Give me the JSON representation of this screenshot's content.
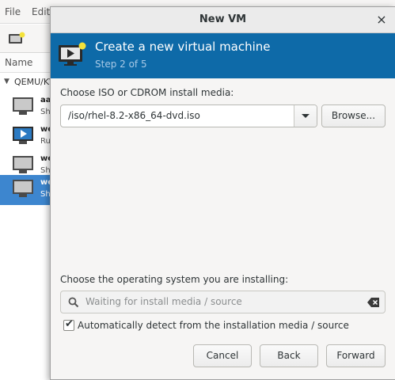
{
  "parent_window": {
    "menu": [
      "File",
      "Edit"
    ],
    "column_header": "Name",
    "group_label": "QEMU/KV",
    "vms": [
      {
        "name": "aa",
        "status": "Sh",
        "icon": "vm-shutoff-icon",
        "selected": false
      },
      {
        "name": "we",
        "status": "Ru",
        "icon": "vm-running-icon",
        "selected": false
      },
      {
        "name": "we",
        "status": "Sh",
        "icon": "vm-shutoff-icon",
        "selected": false
      },
      {
        "name": "we",
        "status": "Sh",
        "icon": "vm-shutoff-icon",
        "selected": true
      }
    ]
  },
  "dialog": {
    "title": "New VM",
    "close_glyph": "×",
    "banner": {
      "heading": "Create a new virtual machine",
      "step": "Step 2 of 5"
    },
    "media_label": "Choose ISO or CDROM install media:",
    "media_value": "/iso/rhel-8.2-x86_64-dvd.iso",
    "browse_label": "Browse...",
    "os_label": "Choose the operating system you are installing:",
    "os_search_placeholder": "Waiting for install media / source",
    "auto_detect_label": "Automatically detect from the installation media / source",
    "auto_detect_checked": true,
    "buttons": {
      "cancel": "Cancel",
      "back": "Back",
      "forward": "Forward"
    }
  },
  "colors": {
    "banner": "#0e6aa8",
    "selection": "#3d86cf"
  }
}
